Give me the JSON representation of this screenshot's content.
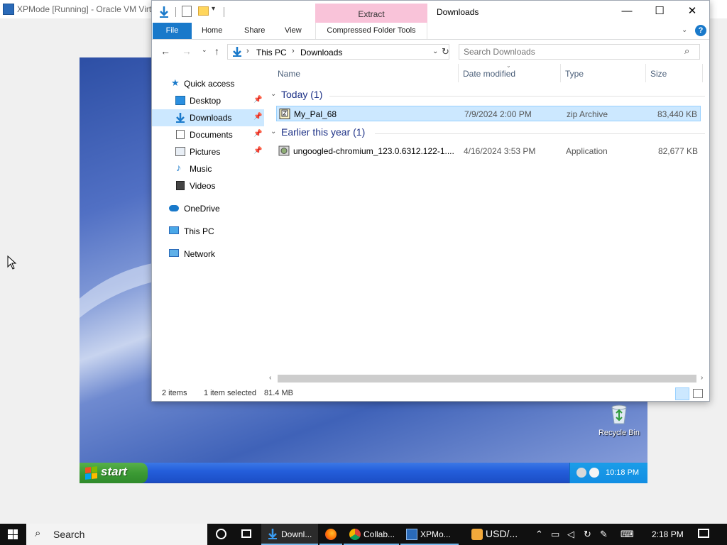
{
  "host": {
    "window_title": "XPMode [Running] - Oracle VM VirtualBox"
  },
  "explorer": {
    "title": "Downloads",
    "contextual_tab_header": "Extract",
    "ribbon_tabs": {
      "file": "File",
      "home": "Home",
      "share": "Share",
      "view": "View",
      "compressed_tools": "Compressed Folder Tools"
    },
    "breadcrumb": [
      "This PC",
      "Downloads"
    ],
    "search_placeholder": "Search Downloads",
    "nav_pane": {
      "quick_access": "Quick access",
      "items": [
        {
          "label": "Desktop",
          "icon": "desktop-icon",
          "pinned": true
        },
        {
          "label": "Downloads",
          "icon": "downloads-icon",
          "pinned": true,
          "selected": true
        },
        {
          "label": "Documents",
          "icon": "documents-icon",
          "pinned": true
        },
        {
          "label": "Pictures",
          "icon": "pictures-icon",
          "pinned": true
        },
        {
          "label": "Music",
          "icon": "music-icon",
          "pinned": false
        },
        {
          "label": "Videos",
          "icon": "videos-icon",
          "pinned": false
        }
      ],
      "onedrive": "OneDrive",
      "this_pc": "This PC",
      "network": "Network"
    },
    "columns": {
      "name": "Name",
      "date": "Date modified",
      "type": "Type",
      "size": "Size"
    },
    "groups": [
      {
        "label": "Today (1)",
        "files": [
          {
            "name": "My_Pal_68",
            "date": "7/9/2024 2:00 PM",
            "type": "zip Archive",
            "size": "83,440 KB",
            "icon": "zip-archive-icon",
            "selected": true
          }
        ]
      },
      {
        "label": "Earlier this year (1)",
        "files": [
          {
            "name": "ungoogled-chromium_123.0.6312.122-1....",
            "date": "4/16/2024 3:53 PM",
            "type": "Application",
            "size": "82,677 KB",
            "icon": "application-icon",
            "selected": false
          }
        ]
      }
    ],
    "status": {
      "items_count": "2 items",
      "selected": "1 item selected",
      "selected_size": "81.4 MB"
    }
  },
  "xp": {
    "start_label": "start",
    "recycle_bin_label": "Recycle Bin",
    "clock": "10:18 PM"
  },
  "win_taskbar": {
    "search_label": "Search",
    "items": [
      {
        "label": "Downl...",
        "icon": "downloads-icon"
      },
      {
        "label": "",
        "icon": "firefox-icon"
      },
      {
        "label": "Collab...",
        "icon": "chrome-icon"
      },
      {
        "label": "XPMo...",
        "icon": "virtualbox-icon"
      },
      {
        "label": "USD/...",
        "icon": "stocks-icon"
      }
    ],
    "clock": "2:18 PM"
  },
  "colors": {
    "accent_blue": "#1979ca",
    "selection": "#cce8ff",
    "extract_header": "#f9c3d9",
    "group_header_text": "#1e3287"
  }
}
